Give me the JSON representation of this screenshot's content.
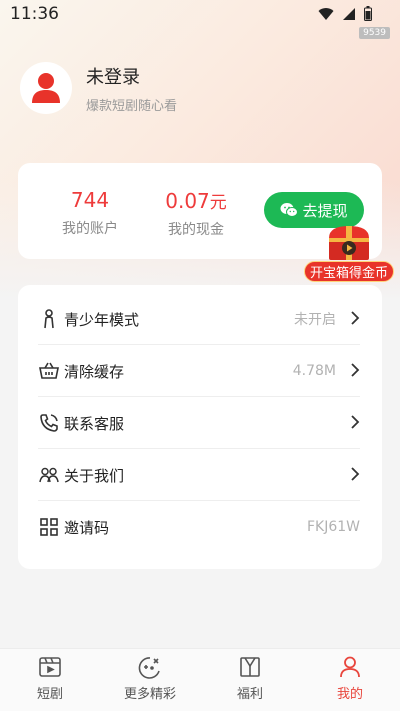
{
  "status_bar": {
    "time": "11:36",
    "badge": "9539",
    "icons": [
      "wifi-icon",
      "signal-icon",
      "battery-icon"
    ]
  },
  "profile": {
    "name": "未登录",
    "subtitle": "爆款短剧随心看"
  },
  "wallet": {
    "account_value": "744",
    "account_label": "我的账户",
    "cash_value": "0.07",
    "cash_unit": "元",
    "cash_label": "我的现金",
    "withdraw_label": "去提现"
  },
  "treasure": {
    "label": "开宝箱得金币"
  },
  "menu": {
    "items": [
      {
        "label": "青少年模式",
        "value": "未开启",
        "icon": "person-icon",
        "chevron": true
      },
      {
        "label": "清除缓存",
        "value": "4.78M",
        "icon": "basket-icon",
        "chevron": true
      },
      {
        "label": "联系客服",
        "value": "",
        "icon": "phone-icon",
        "chevron": true
      },
      {
        "label": "关于我们",
        "value": "",
        "icon": "group-icon",
        "chevron": true
      },
      {
        "label": "邀请码",
        "value": "FKJ61W",
        "icon": "qrcode-icon",
        "chevron": false
      }
    ]
  },
  "tabs": [
    {
      "label": "短剧",
      "icon": "film-icon",
      "active": false
    },
    {
      "label": "更多精彩",
      "icon": "gamepad-icon",
      "active": false
    },
    {
      "label": "福利",
      "icon": "gift-icon",
      "active": false
    },
    {
      "label": "我的",
      "icon": "user-icon",
      "active": true
    }
  ],
  "colors": {
    "accent_red": "#ee3b3b",
    "withdraw_green": "#1db955",
    "tab_active": "#e8453c"
  }
}
